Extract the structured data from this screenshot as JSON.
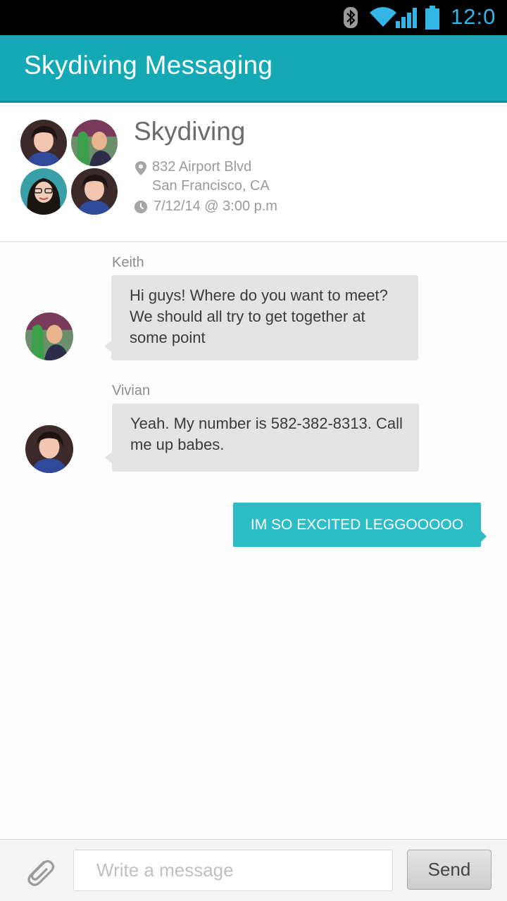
{
  "status_bar": {
    "time": "12:0",
    "icons": [
      "bluetooth-icon",
      "wifi-icon",
      "cell-signal-icon",
      "battery-icon"
    ],
    "accent_color": "#33b5e5"
  },
  "app_bar": {
    "title": "Skydiving Messaging",
    "color": "#15a9b5"
  },
  "event": {
    "title": "Skydiving",
    "address_line1": "832 Airport Blvd",
    "address_line2": "San Francisco, CA",
    "datetime": "7/12/14 @ 3:00 p.m",
    "icons": [
      "location-pin-icon",
      "clock-icon"
    ]
  },
  "messages": [
    {
      "sender": "Keith",
      "lines": [
        "Hi guys! Where do you want to meet?",
        "We should all try to get together at",
        "some point"
      ]
    },
    {
      "sender": "Vivian",
      "lines": [
        "Yeah. My number is 582-382-8313. Call",
        "me up babes."
      ]
    },
    {
      "sender": "me",
      "text": "IM SO EXCITED LEGGOOOOO",
      "color": "#2cbdc6"
    }
  ],
  "composer": {
    "placeholder": "Write a message",
    "value": "",
    "send_label": "Send",
    "attach_icon": "paperclip-icon"
  }
}
